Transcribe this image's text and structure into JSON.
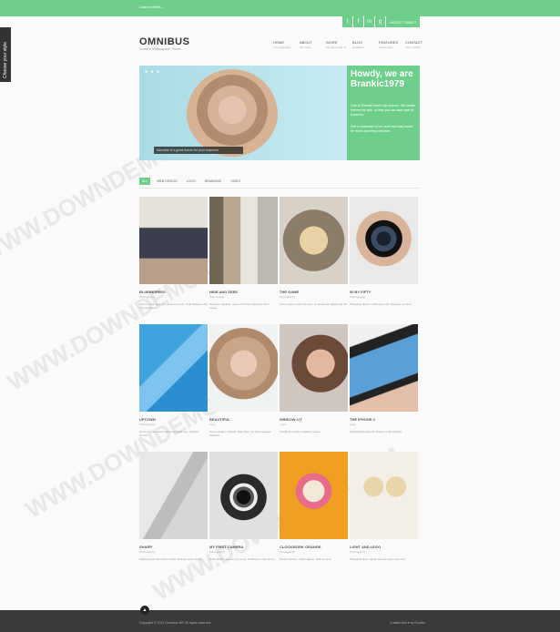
{
  "topbar": {
    "note": "Latest tweets..."
  },
  "social": [
    "t",
    "f",
    "in",
    "g"
  ],
  "latest_label": "LATEST TWEET",
  "side_tab": "Choose your style",
  "logo": "OMNIBUS",
  "tagline": "Creative Multipurpose Theme",
  "nav": [
    {
      "label": "HOME",
      "sub": "The beginning"
    },
    {
      "label": "ABOUT",
      "sub": "Our team"
    },
    {
      "label": "WORK",
      "sub": "We are proud of"
    },
    {
      "label": "BLOG",
      "sub": "Headlines"
    },
    {
      "label": "FEATURES",
      "sub": "Know more"
    },
    {
      "label": "CONTACT",
      "sub": "Get in touch"
    }
  ],
  "hero": {
    "dots": "● ● ●",
    "caption": "Adorable is a great theme for your business"
  },
  "promo": {
    "title": "Howdy, we are Brankic1979",
    "body1": "One of ThemeForest's top authors. We create themes for web, so that you can take care of business.",
    "body2": "See a showcase of our work and stay tuned for more upcoming releases."
  },
  "filters": [
    {
      "label": "ALL",
      "active": true
    },
    {
      "label": "WEB DESIGN"
    },
    {
      "label": "LOGO"
    },
    {
      "label": "BRANDING"
    },
    {
      "label": "VIDEO"
    }
  ],
  "portfolio": [
    {
      "title": "BLUEBERRIES",
      "cat": "Photography",
      "desc": "Morbi in sem quis dui placerat ornare. Pellentesque odio nisi euismod in."
    },
    {
      "title": "HIDE AND SEEK",
      "cat": "Web Design",
      "desc": "Praesent dapibus, neque id cursus faucibus tortor neque."
    },
    {
      "title": "THE GAME",
      "cat": "Photography",
      "desc": "Lorem ipsum dolor sit amet, consectetuer adipiscing elit."
    },
    {
      "title": "50 BY FIFTY",
      "cat": "Photography",
      "desc": "Phasellus ultrices nulla quis nibh. Quisque a lectus."
    },
    {
      "title": "UPTOWN",
      "cat": "Photography",
      "desc": "Donec consectetuer ligula vulputate sem tristique cursus."
    },
    {
      "title": "BEAUTIFUL",
      "cat": "Logo",
      "desc": "Nam a sapien. Integer vitae libero ac risus egestas placerat."
    },
    {
      "title": "WINDOW LIT",
      "cat": "Logo",
      "desc": "Vestibulum auctor dapibus neque."
    },
    {
      "title": "THE IPHONE 4",
      "cat": "Logo",
      "desc": "Suspendisse potenti. Aliquam erat volutpat."
    },
    {
      "title": "SHARP",
      "cat": "Photography",
      "desc": "Pellentesque fermentum dolor. Aliquam quam lectus."
    },
    {
      "title": "MY FIRST CAMERA",
      "cat": "Photography",
      "desc": "Nulla facilisi. Aenean nec eros. Vestibulum ante ipsum."
    },
    {
      "title": "CLOCKWORK ORANGE",
      "cat": "Photography",
      "desc": "Morbi interdum mollis sapien. Sed ac risus."
    },
    {
      "title": "LIGHT AND LEGO",
      "cat": "Photography",
      "desc": "Phasellus lacus. Etiam laoreet quam sed arcu."
    }
  ],
  "footer": {
    "left": "Copyright © 2012 Omnibus WP. All rights reserved.",
    "right": "Crafted with ♥ by Brankic",
    "up": "▲"
  },
  "watermark": "WWW.DOWNDEMO.COM",
  "colors": {
    "accent": "#6ecf8a",
    "footer": "#3a3a3a"
  }
}
